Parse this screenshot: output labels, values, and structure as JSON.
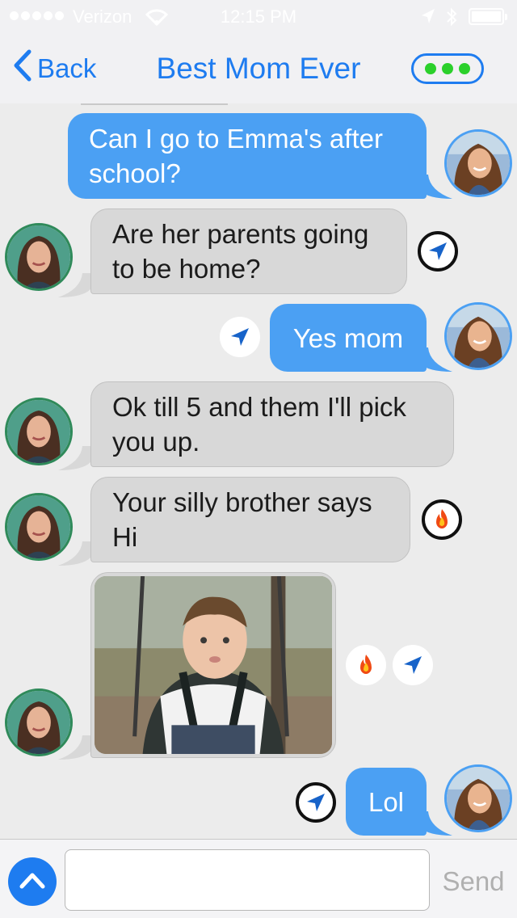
{
  "status_bar": {
    "carrier": "Verizon",
    "time": "12:15 PM",
    "signal_bars": 5,
    "battery_level": 1.0
  },
  "nav": {
    "back_label": "Back",
    "title": "Best Mom Ever"
  },
  "messages": [
    {
      "direction": "out",
      "lines": [
        "Can I go to Emma's after",
        "school?"
      ]
    },
    {
      "direction": "in",
      "lines": [
        "Are her parents going",
        "to be home?"
      ],
      "reaction": "location-arrow-icon"
    },
    {
      "direction": "out",
      "lines": [
        "Yes mom"
      ],
      "reaction": "location-arrow-icon"
    },
    {
      "direction": "in",
      "lines": [
        "Ok till 5 and them I'll pick",
        "you up."
      ]
    },
    {
      "direction": "in",
      "lines": [
        "Your silly brother says",
        "Hi"
      ],
      "reaction": "fire-icon"
    },
    {
      "direction": "in",
      "type": "photo",
      "reactions": [
        "fire-icon",
        "location-arrow-icon"
      ]
    },
    {
      "direction": "out",
      "lines": [
        "Lol"
      ],
      "reaction": "location-arrow-icon"
    }
  ],
  "composer": {
    "placeholder": "",
    "send_label": "Send"
  },
  "colors": {
    "accent": "#1e7cf0",
    "outgoing_bubble": "#4ba0f3",
    "incoming_bubble": "#d8d8d8",
    "presence_dots": "#2bd02b"
  }
}
